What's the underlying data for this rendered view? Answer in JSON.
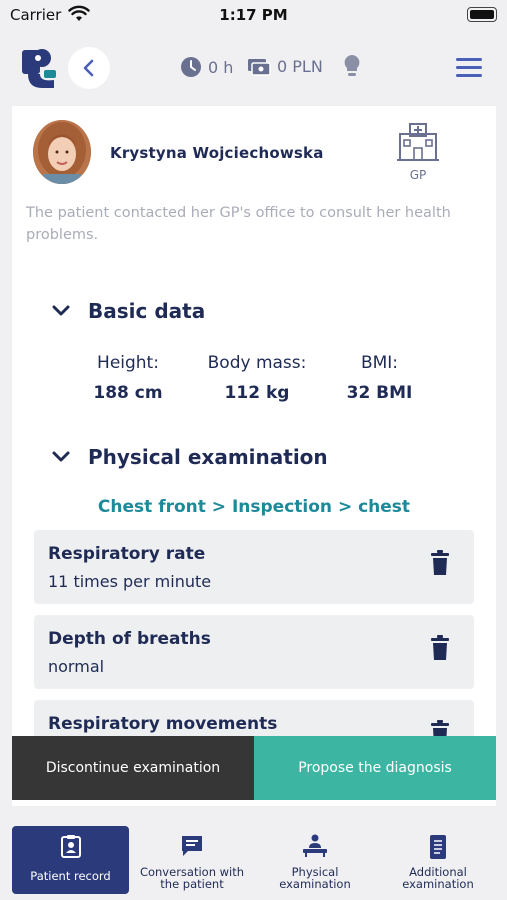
{
  "status_bar": {
    "carrier": "Carrier",
    "time": "1:17 PM"
  },
  "header": {
    "time_stat": "0 h",
    "money_stat": "0 PLN"
  },
  "patient": {
    "name": "Krystyna Wojciechowska",
    "facility_label": "GP",
    "description": "The patient contacted her GP's office to consult her health problems."
  },
  "basic_data": {
    "title": "Basic data",
    "fields": [
      {
        "label": "Height:",
        "value": "188 cm"
      },
      {
        "label": "Body mass:",
        "value": "112 kg"
      },
      {
        "label": "BMI:",
        "value": "32 BMI"
      }
    ]
  },
  "physical_exam": {
    "title": "Physical examination",
    "breadcrumb": "Chest front > Inspection > chest",
    "findings": [
      {
        "title": "Respiratory rate",
        "value": "11 times per minute"
      },
      {
        "title": "Depth of breaths",
        "value": "normal"
      },
      {
        "title": "Respiratory movements",
        "value": ""
      }
    ]
  },
  "actions": {
    "discontinue": "Discontinue examination",
    "propose": "Propose the diagnosis"
  },
  "tabs": [
    {
      "label": "Patient record",
      "icon": "patient-record-icon",
      "active": true
    },
    {
      "label": "Conversation with the patient",
      "icon": "chat-icon",
      "active": false
    },
    {
      "label": "Physical examination",
      "icon": "physical-exam-icon",
      "active": false
    },
    {
      "label": "Additional examination",
      "icon": "additional-exam-icon",
      "active": false
    }
  ],
  "colors": {
    "primary": "#1f2b55",
    "accent_teal": "#3cb6a3",
    "breadcrumb_teal": "#1d8a9a",
    "dark_button": "#363636",
    "active_tab": "#2a3a7a",
    "menu_blue": "#4a5fb8"
  }
}
